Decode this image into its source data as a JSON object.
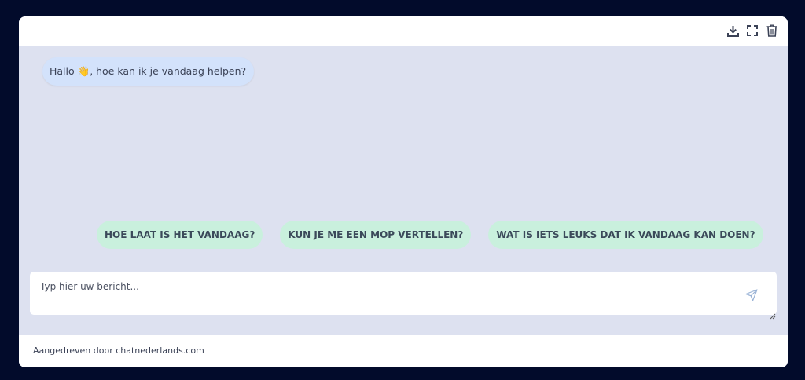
{
  "toolbar": {
    "icons": [
      "download-icon",
      "fullscreen-icon",
      "trash-icon"
    ]
  },
  "chat": {
    "greeting": "Hallo 👋, hoe kan ik je vandaag helpen?",
    "suggestions": [
      "HOE LAAT IS HET VANDAAG?",
      "KUN JE ME EEN MOP VERTELLEN?",
      "WAT IS IETS LEUKS DAT IK VANDAAG KAN DOEN?"
    ]
  },
  "composer": {
    "placeholder": "Typ hier uw bericht...",
    "value": ""
  },
  "footer": {
    "powered_by": "Aangedreven door chatnederlands.com"
  },
  "colors": {
    "page_background": "#020b2b",
    "chat_background": "#dde1f0",
    "bot_bubble": "#d3e2fb",
    "suggestion_chip": "#c9f0dd"
  }
}
